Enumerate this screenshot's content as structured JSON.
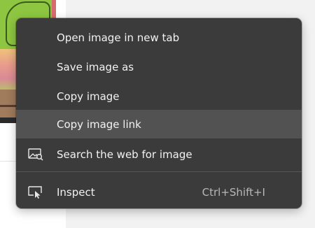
{
  "context_menu": {
    "items": [
      {
        "label": "Open image in new tab",
        "icon": ""
      },
      {
        "label": "Save image as",
        "icon": ""
      },
      {
        "label": "Copy image",
        "icon": ""
      },
      {
        "label": "Copy image link",
        "icon": "",
        "highlighted": true
      },
      {
        "label": "Search the web for image",
        "icon": "image-search-icon"
      },
      {
        "label": "Inspect",
        "icon": "inspect-icon",
        "shortcut": "Ctrl+Shift+I"
      }
    ]
  },
  "colors": {
    "menu_background": "#3b3b3b",
    "highlight": "#525252",
    "text": "#f2f2f2",
    "shortcut_text": "#b8b8b8"
  }
}
